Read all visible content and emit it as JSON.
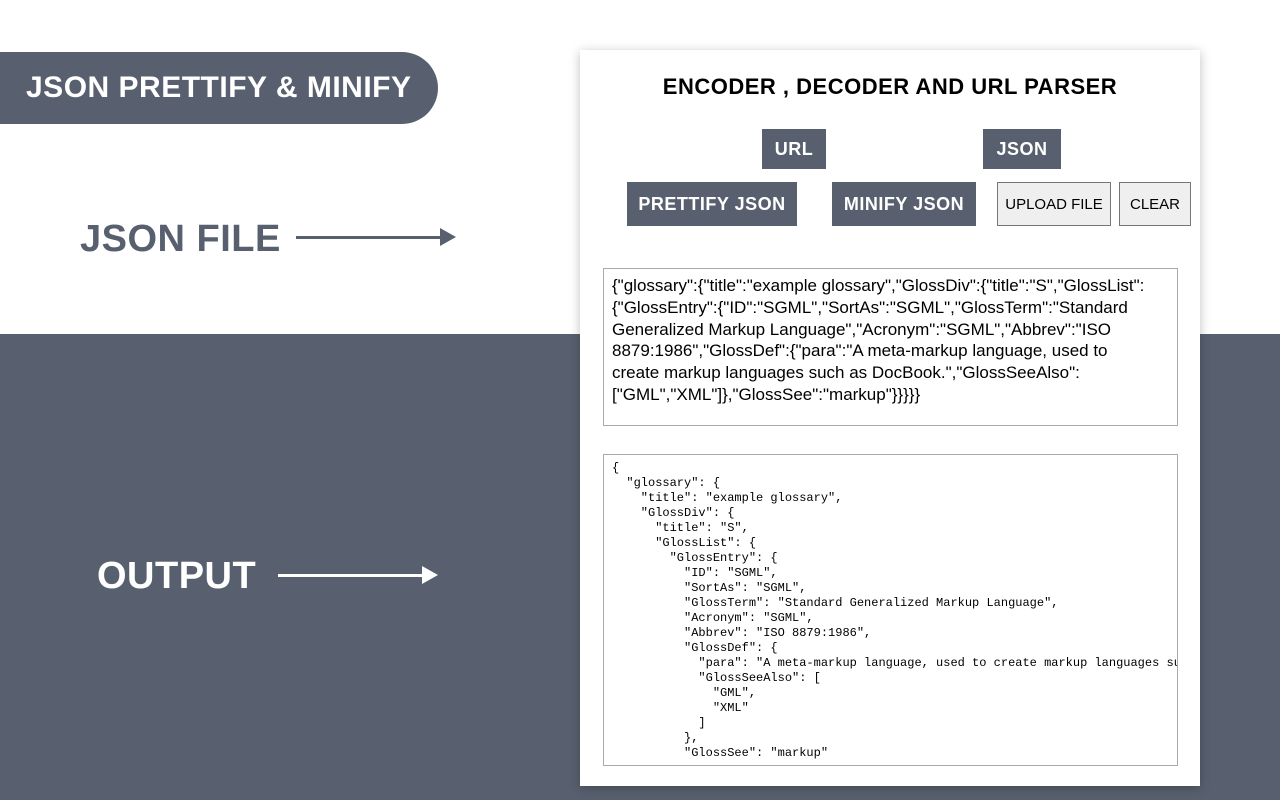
{
  "left": {
    "pill_title": "JSON PRETTIFY & MINIFY",
    "json_file_label": "JSON FILE",
    "output_label": "OUTPUT"
  },
  "panel": {
    "title": "ENCODER , DECODER AND URL PARSER",
    "tabs": {
      "url": "URL",
      "json": "JSON"
    },
    "buttons": {
      "prettify": "PRETTIFY JSON",
      "minify": "MINIFY JSON",
      "upload": "UPLOAD FILE",
      "clear": "CLEAR"
    },
    "input_value": "{\"glossary\":{\"title\":\"example glossary\",\"GlossDiv\":{\"title\":\"S\",\"GlossList\":{\"GlossEntry\":{\"ID\":\"SGML\",\"SortAs\":\"SGML\",\"GlossTerm\":\"Standard Generalized Markup Language\",\"Acronym\":\"SGML\",\"Abbrev\":\"ISO 8879:1986\",\"GlossDef\":{\"para\":\"A meta-markup language, used to create markup languages such as DocBook.\",\"GlossSeeAlso\":[\"GML\",\"XML\"]},\"GlossSee\":\"markup\"}}}}}",
    "output_value": "{\n  \"glossary\": {\n    \"title\": \"example glossary\",\n    \"GlossDiv\": {\n      \"title\": \"S\",\n      \"GlossList\": {\n        \"GlossEntry\": {\n          \"ID\": \"SGML\",\n          \"SortAs\": \"SGML\",\n          \"GlossTerm\": \"Standard Generalized Markup Language\",\n          \"Acronym\": \"SGML\",\n          \"Abbrev\": \"ISO 8879:1986\",\n          \"GlossDef\": {\n            \"para\": \"A meta-markup language, used to create markup languages such as DocBook.\",\n            \"GlossSeeAlso\": [\n              \"GML\",\n              \"XML\"\n            ]\n          },\n          \"GlossSee\": \"markup\""
  }
}
